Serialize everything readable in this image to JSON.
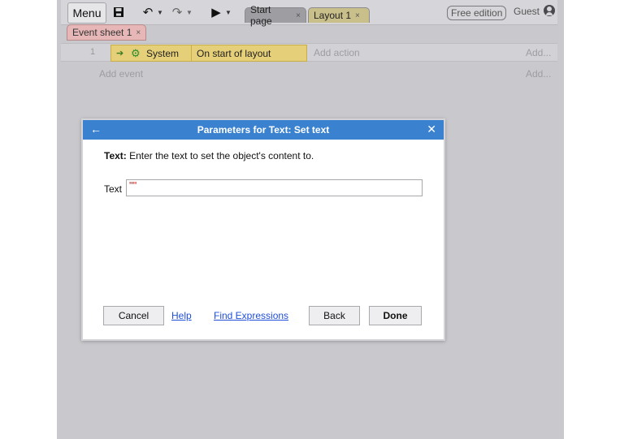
{
  "toolbar": {
    "menu_label": "Menu",
    "tabs": [
      {
        "label": "Start page",
        "close": "×"
      },
      {
        "label": "Layout 1",
        "close": "×"
      }
    ],
    "edition_label": "Free edition",
    "user_label": "Guest"
  },
  "event_sheet": {
    "tab_label": "Event sheet 1",
    "tab_close": "×",
    "events": [
      {
        "number": "1",
        "condition_object": "System",
        "condition_text": "On start of layout",
        "add_action": "Add action",
        "add": "Add..."
      }
    ],
    "add_event": "Add event",
    "add_right": "Add..."
  },
  "dialog": {
    "title": "Parameters for Text: Set text",
    "param_name_bold": "Text:",
    "description": " Enter the text to set the object's content to.",
    "param_label": "Text",
    "param_value": "\"\"",
    "buttons": {
      "cancel": "Cancel",
      "help": "Help",
      "find_expressions": "Find Expressions",
      "back": "Back",
      "done": "Done"
    }
  },
  "colors": {
    "dialog_title_bg": "#3a82cf",
    "condition_bg": "#e5cf78",
    "link": "#1f4ed8"
  }
}
